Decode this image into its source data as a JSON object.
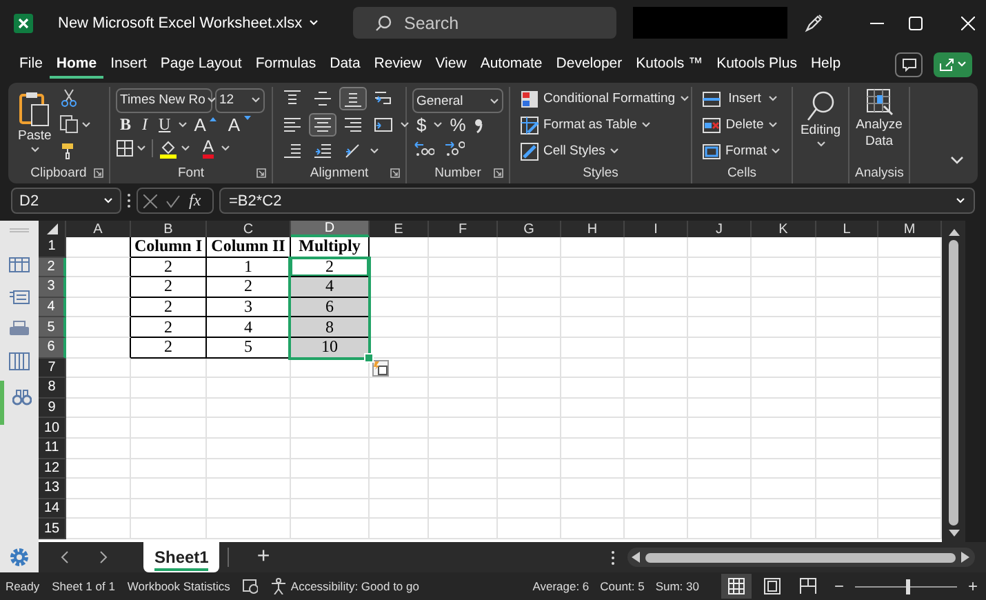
{
  "window": {
    "title": "New Microsoft Excel Worksheet.xlsx"
  },
  "search": {
    "placeholder": "Search"
  },
  "menu_tabs": [
    {
      "label": "File",
      "selected": false
    },
    {
      "label": "Home",
      "selected": true
    },
    {
      "label": "Insert",
      "selected": false
    },
    {
      "label": "Page Layout",
      "selected": false
    },
    {
      "label": "Formulas",
      "selected": false
    },
    {
      "label": "Data",
      "selected": false
    },
    {
      "label": "Review",
      "selected": false
    },
    {
      "label": "View",
      "selected": false
    },
    {
      "label": "Automate",
      "selected": false
    },
    {
      "label": "Developer",
      "selected": false
    },
    {
      "label": "Kutools ™",
      "selected": false
    },
    {
      "label": "Kutools Plus",
      "selected": false
    },
    {
      "label": "Help",
      "selected": false
    }
  ],
  "ribbon": {
    "clipboard": {
      "paste": "Paste",
      "label": "Clipboard"
    },
    "font": {
      "font_name": "Times New Ro",
      "font_size": "12",
      "styles": [
        "B",
        "I",
        "U"
      ],
      "size_buttons": [
        "A",
        "A"
      ],
      "font_color": "A",
      "label": "Font"
    },
    "alignment": {
      "rows": [
        [
          {
            "kind": "top",
            "selected": false
          },
          {
            "kind": "middle",
            "selected": false
          },
          {
            "kind": "bottom",
            "selected": true
          },
          {
            "kind": "wrap",
            "selected": false
          }
        ],
        [
          {
            "kind": "left",
            "selected": false
          },
          {
            "kind": "center",
            "selected": true
          },
          {
            "kind": "right",
            "selected": false
          },
          {
            "kind": "merge",
            "selected": false
          }
        ],
        [
          {
            "kind": "outdent",
            "selected": false
          },
          {
            "kind": "indent",
            "selected": false
          },
          {
            "kind": "orientation",
            "selected": false
          }
        ]
      ],
      "label": "Alignment"
    },
    "number": {
      "format": "General",
      "symbols": [
        "$",
        "%"
      ],
      "label": "Number"
    },
    "styles": {
      "buttons": [
        "Conditional Formatting",
        "Format as Table",
        "Cell Styles"
      ],
      "label": "Styles"
    },
    "cells": {
      "buttons": [
        "Insert",
        "Delete",
        "Format"
      ],
      "label": "Cells"
    },
    "editing": {
      "button": "Editing"
    },
    "analysis": {
      "button": "Analyze Data",
      "label": "Analysis"
    }
  },
  "formula_bar": {
    "name_box": "D2",
    "fx": "fx",
    "formula": "=B2*C2"
  },
  "sheet": {
    "columns": [
      {
        "label": "A",
        "selected": false
      },
      {
        "label": "B",
        "selected": false
      },
      {
        "label": "C",
        "selected": false
      },
      {
        "label": "D",
        "selected": true
      },
      {
        "label": "E",
        "selected": false
      },
      {
        "label": "F",
        "selected": false
      },
      {
        "label": "G",
        "selected": false
      },
      {
        "label": "H",
        "selected": false
      },
      {
        "label": "I",
        "selected": false
      },
      {
        "label": "J",
        "selected": false
      },
      {
        "label": "K",
        "selected": false
      },
      {
        "label": "L",
        "selected": false
      },
      {
        "label": "M",
        "selected": false
      }
    ],
    "rows": [
      {
        "label": "1",
        "selected": false
      },
      {
        "label": "2",
        "selected": true
      },
      {
        "label": "3",
        "selected": true
      },
      {
        "label": "4",
        "selected": true
      },
      {
        "label": "5",
        "selected": true
      },
      {
        "label": "6",
        "selected": true
      },
      {
        "label": "7",
        "selected": false
      },
      {
        "label": "8",
        "selected": false
      },
      {
        "label": "9",
        "selected": false
      },
      {
        "label": "10",
        "selected": false
      },
      {
        "label": "11",
        "selected": false
      },
      {
        "label": "12",
        "selected": false
      },
      {
        "label": "13",
        "selected": false
      },
      {
        "label": "14",
        "selected": false
      },
      {
        "label": "15",
        "selected": false
      }
    ],
    "table": [
      {
        "kind": "header",
        "cells": [
          {
            "text": "Column I",
            "selected": false,
            "active": false
          },
          {
            "text": "Column II",
            "selected": false,
            "active": false
          },
          {
            "text": "Multiply",
            "selected": false,
            "active": false
          }
        ]
      },
      {
        "kind": "data",
        "cells": [
          {
            "text": "2",
            "selected": false,
            "active": false
          },
          {
            "text": "1",
            "selected": false,
            "active": false
          },
          {
            "text": "2",
            "selected": true,
            "active": true
          }
        ]
      },
      {
        "kind": "data",
        "cells": [
          {
            "text": "2",
            "selected": false,
            "active": false
          },
          {
            "text": "2",
            "selected": false,
            "active": false
          },
          {
            "text": "4",
            "selected": true,
            "active": false
          }
        ]
      },
      {
        "kind": "data",
        "cells": [
          {
            "text": "2",
            "selected": false,
            "active": false
          },
          {
            "text": "3",
            "selected": false,
            "active": false
          },
          {
            "text": "6",
            "selected": true,
            "active": false
          }
        ]
      },
      {
        "kind": "data",
        "cells": [
          {
            "text": "2",
            "selected": false,
            "active": false
          },
          {
            "text": "4",
            "selected": false,
            "active": false
          },
          {
            "text": "8",
            "selected": true,
            "active": false
          }
        ]
      },
      {
        "kind": "data",
        "cells": [
          {
            "text": "2",
            "selected": false,
            "active": false
          },
          {
            "text": "5",
            "selected": false,
            "active": false
          },
          {
            "text": "10",
            "selected": true,
            "active": false
          }
        ]
      }
    ]
  },
  "sheet_tabs": [
    {
      "label": "Sheet1",
      "selected": true
    }
  ],
  "add_sheet": "+",
  "status_bar": {
    "ready": "Ready",
    "sheet": "Sheet 1 of 1",
    "stats": "Workbook Statistics",
    "accessibility": "Accessibility: Good to go",
    "average": "Average: 6",
    "count": "Count: 5",
    "sum": "Sum: 30",
    "views": [
      {
        "kind": "normal",
        "selected": true
      },
      {
        "kind": "page_layout",
        "selected": false
      },
      {
        "kind": "page_break",
        "selected": false
      }
    ],
    "zoom": {
      "minus": "−",
      "plus": "+",
      "level": 0.52
    }
  }
}
